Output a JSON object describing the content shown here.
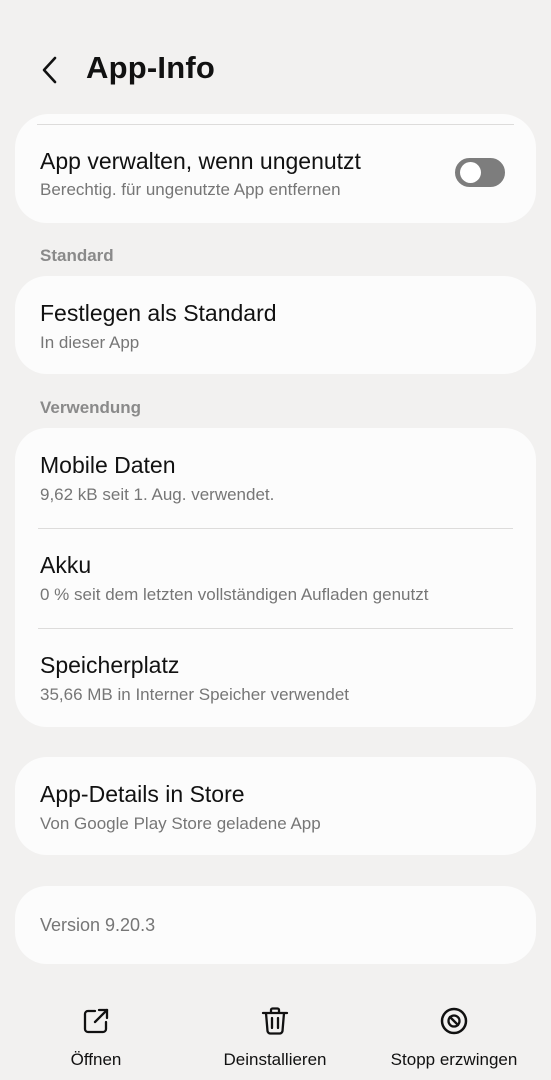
{
  "header": {
    "title": "App-Info"
  },
  "manage_card": {
    "title": "App verwalten, wenn ungenutzt",
    "subtitle": "Berechtig. für ungenutzte App entfernen",
    "toggle_on": false
  },
  "section_standard": {
    "label": "Standard"
  },
  "standard_card": {
    "title": "Festlegen als Standard",
    "subtitle": "In dieser App"
  },
  "section_usage": {
    "label": "Verwendung"
  },
  "usage_items": [
    {
      "title": "Mobile Daten",
      "subtitle": "9,62 kB seit 1. Aug. verwendet."
    },
    {
      "title": "Akku",
      "subtitle": "0 % seit dem letzten vollständigen Aufladen genutzt"
    },
    {
      "title": "Speicherplatz",
      "subtitle": "35,66 MB in Interner Speicher verwendet"
    }
  ],
  "store_card": {
    "title": "App-Details in Store",
    "subtitle": "Von Google Play Store geladene App"
  },
  "version_card": {
    "text": "Version 9.20.3"
  },
  "bottom_bar": {
    "open_label": "Öffnen",
    "uninstall_label": "Deinstallieren",
    "force_stop_label": "Stopp erzwingen"
  }
}
